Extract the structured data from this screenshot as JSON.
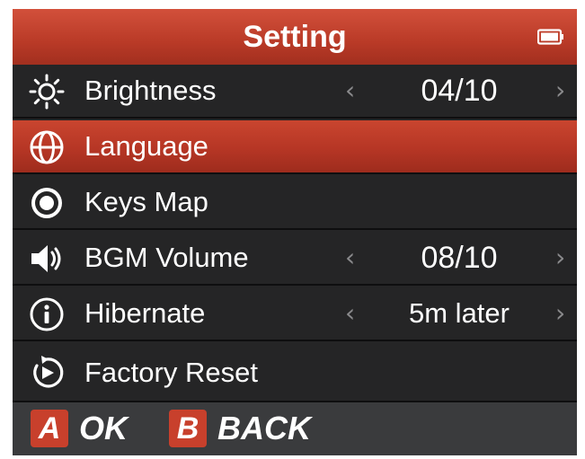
{
  "header": {
    "title": "Setting",
    "battery_icon": "battery-icon"
  },
  "menu": {
    "items": [
      {
        "label": "Brightness",
        "icon": "sun-icon",
        "value": "04/10",
        "has_arrows": true,
        "selected": false
      },
      {
        "label": "Language",
        "icon": "globe-icon",
        "value": "",
        "has_arrows": false,
        "selected": true
      },
      {
        "label": "Keys Map",
        "icon": "keys-map-icon",
        "value": "",
        "has_arrows": false,
        "selected": false
      },
      {
        "label": "BGM Volume",
        "icon": "speaker-icon",
        "value": "08/10",
        "has_arrows": true,
        "selected": false
      },
      {
        "label": "Hibernate",
        "icon": "info-icon",
        "value": "5m later",
        "has_arrows": true,
        "selected": false
      },
      {
        "label": "Factory Reset",
        "icon": "reset-icon",
        "value": "",
        "has_arrows": false,
        "selected": false
      }
    ],
    "arrow_left": "‹",
    "arrow_right": "›"
  },
  "footer": {
    "ok_key": "A",
    "ok_label": "OK",
    "back_key": "B",
    "back_label": "BACK"
  },
  "colors": {
    "accent": "#c8402c",
    "background": "#252526",
    "footer": "#3a3b3d",
    "text": "#ffffff",
    "arrow": "#8a8a8c"
  }
}
